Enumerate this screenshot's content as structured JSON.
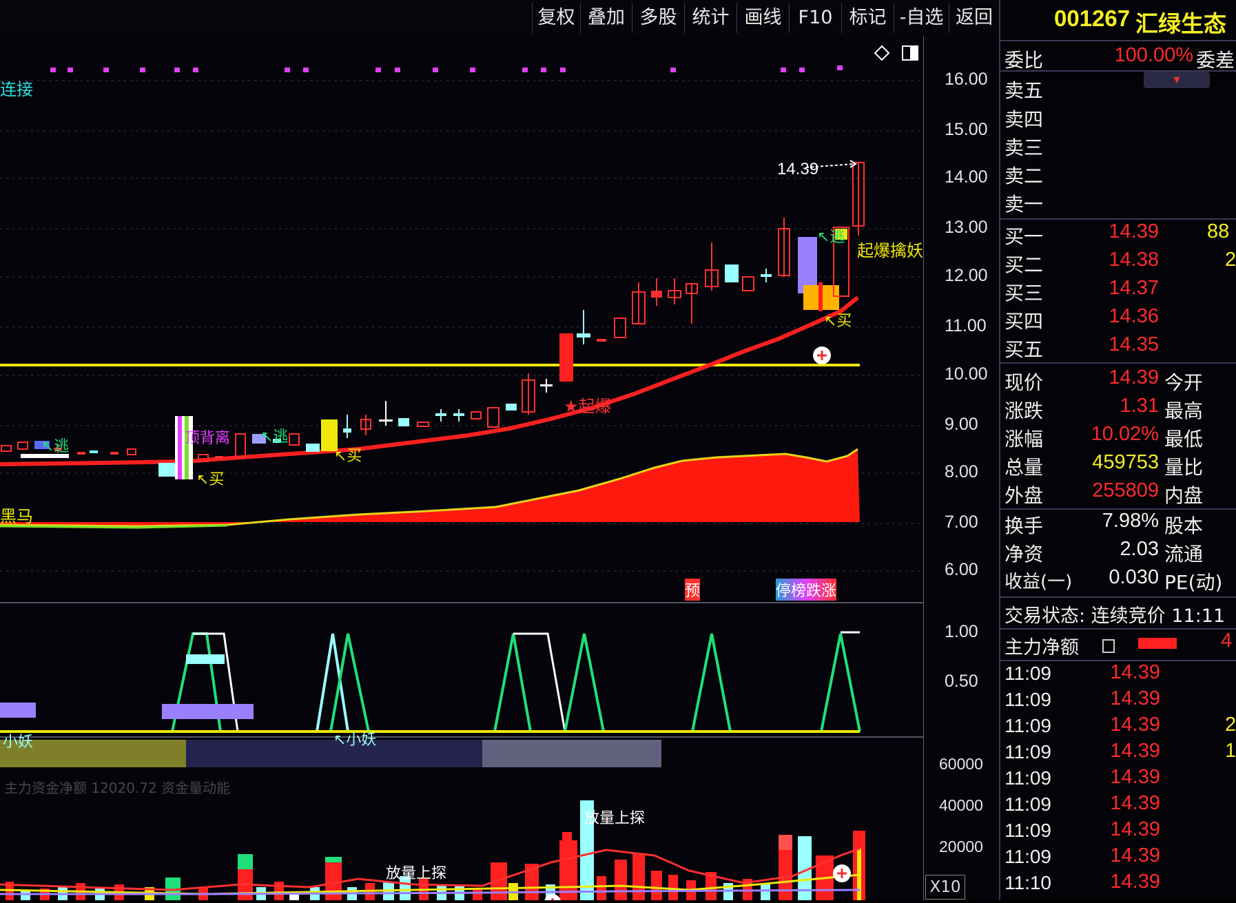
{
  "toolbar": {
    "buttons": [
      "复权",
      "叠加",
      "多股",
      "统计",
      "画线",
      "F10",
      "标记",
      "-自选",
      "返回"
    ]
  },
  "stock": {
    "code": "001267",
    "name": "汇绿生态"
  },
  "chart": {
    "y_labels": [
      "16.00",
      "15.00",
      "14.00",
      "13.00",
      "12.00",
      "11.00",
      "10.00",
      "9.00",
      "8.00",
      "7.00",
      "6.00"
    ],
    "price_tag": "14.39",
    "annotations": {
      "lianjie": "连接",
      "heima": "黑马",
      "qibao": "起爆擒妖",
      "qi": "★起爆",
      "mai1": "↖买",
      "mai2": "↖买",
      "mai3": "↖买",
      "tao1": "↖逃",
      "tao2": "↖逃",
      "tao3": "↖逃",
      "beili": "顶背离",
      "yu": "预",
      "tingbang": "停榜跌涨"
    },
    "sub_labels": [
      "1.00",
      "0.50"
    ],
    "sub_text": {
      "xiaoyao1": "小妖",
      "xiaoyao2": "↖小妖"
    },
    "vol_labels": [
      "60000",
      "40000",
      "20000"
    ],
    "vol_text": {
      "fl1": "放量上探",
      "fl2": "放量上探"
    },
    "vol_unit": "X10",
    "indicator_header": "主力资金净额 12020.72 资金量动能"
  },
  "panel": {
    "weibi_label": "委比",
    "weibi_value": "100.00%",
    "weicha_label": "委差",
    "sell_labels": [
      "卖五",
      "卖四",
      "卖三",
      "卖二",
      "卖一"
    ],
    "buy": [
      {
        "label": "买一",
        "price": "14.39",
        "vol": "88"
      },
      {
        "label": "买二",
        "price": "14.38",
        "vol": "2"
      },
      {
        "label": "买三",
        "price": "14.37",
        "vol": ""
      },
      {
        "label": "买四",
        "price": "14.36",
        "vol": ""
      },
      {
        "label": "买五",
        "price": "14.35",
        "vol": ""
      }
    ],
    "stats": [
      {
        "l": "现价",
        "v": "14.39",
        "c": "red",
        "r": "今开"
      },
      {
        "l": "涨跌",
        "v": "1.31",
        "c": "red",
        "r": "最高"
      },
      {
        "l": "涨幅",
        "v": "10.02%",
        "c": "red",
        "r": "最低"
      },
      {
        "l": "总量",
        "v": "459753",
        "c": "yel",
        "r": "量比"
      },
      {
        "l": "外盘",
        "v": "255809",
        "c": "red",
        "r": "内盘"
      },
      {
        "l": "换手",
        "v": "7.98%",
        "c": "wht",
        "r": "股本"
      },
      {
        "l": "净资",
        "v": "2.03",
        "c": "wht",
        "r": "流通"
      },
      {
        "l": "收益(一)",
        "v": "0.030",
        "c": "wht",
        "r": "PE(动)"
      }
    ],
    "trade_status": "交易状态: 连续竞价 11:11",
    "main_net": "主力净额",
    "main_net_val": "4",
    "ticks": [
      {
        "t": "11:09",
        "p": "14.39",
        "v": ""
      },
      {
        "t": "11:09",
        "p": "14.39",
        "v": ""
      },
      {
        "t": "11:09",
        "p": "14.39",
        "v": "2"
      },
      {
        "t": "11:09",
        "p": "14.39",
        "v": "1"
      },
      {
        "t": "11:09",
        "p": "14.39",
        "v": ""
      },
      {
        "t": "11:09",
        "p": "14.39",
        "v": ""
      },
      {
        "t": "11:09",
        "p": "14.39",
        "v": ""
      },
      {
        "t": "11:09",
        "p": "14.39",
        "v": ""
      },
      {
        "t": "11:10",
        "p": "14.39",
        "v": ""
      }
    ]
  }
}
